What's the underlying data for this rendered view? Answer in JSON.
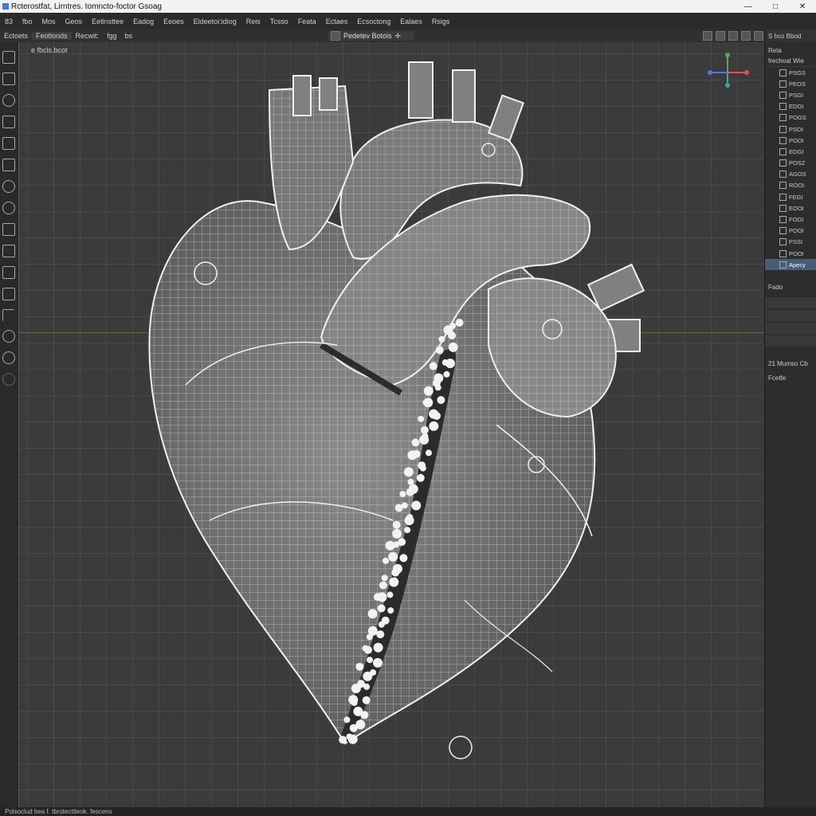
{
  "window": {
    "title": "Rcterostfat, Lirntres. tomncto-foctor Gsoag",
    "controls": [
      "—",
      "□",
      "✕"
    ]
  },
  "menu": [
    "83",
    "fbo",
    "Mos",
    "Geos",
    "Eetinsttee",
    "Eadog",
    "Eeoes",
    "Eldeetoi:idiog",
    "Reis",
    "Tcsso",
    "Feata",
    "Ectaes",
    "Ecsoctong",
    "Ealaes",
    "Rsigs"
  ],
  "toolbar": {
    "buttons": [
      "Ectoets",
      "Feotlonds",
      "Recwit:",
      "fgg",
      "bs"
    ],
    "viewport_tab": "Pedetev Botois",
    "right_icons": [
      "grid-icon",
      "layout-icon",
      "screen-icon",
      "window-icon",
      "square-icon"
    ]
  },
  "left_tools": [
    "select-icon",
    "move-icon",
    "rotate-icon",
    "scale-icon",
    "paint-icon",
    "measure-icon",
    "cut-icon",
    "lasso-icon",
    "transform-icon",
    "mesh-icon",
    "brush-icon",
    "frame-icon",
    "axis-icon",
    "sphere-icon",
    "orbit-icon",
    "dots-icon"
  ],
  "viewport": {
    "label": "e͏ fbcls.bcot"
  },
  "right_panel": {
    "header": "S hco Bbod",
    "subheader": "Reta",
    "tree_root": "frechoat Wie",
    "items": [
      "PSGS",
      "PEOS",
      "PSGI",
      "EDOI",
      "POGS",
      "PSOI",
      "POOI",
      "EDGI",
      "POSZ",
      "AGOS",
      "ROOI",
      "FEGI",
      "EOOI",
      "FOOI",
      "POOI",
      "PSSI",
      "POOI",
      "Apecy"
    ],
    "selected_index": 17,
    "section1": "Fado",
    "section2": "21 Mumso Cb",
    "section3": "Fcetfe"
  },
  "status": {
    "text": "Polsoclud bea f. tbrotecttleok. fescens"
  },
  "colors": {
    "selection": "#4a5c78",
    "viewport": "#3b3b3b",
    "mesh": "#e8e8e8"
  }
}
